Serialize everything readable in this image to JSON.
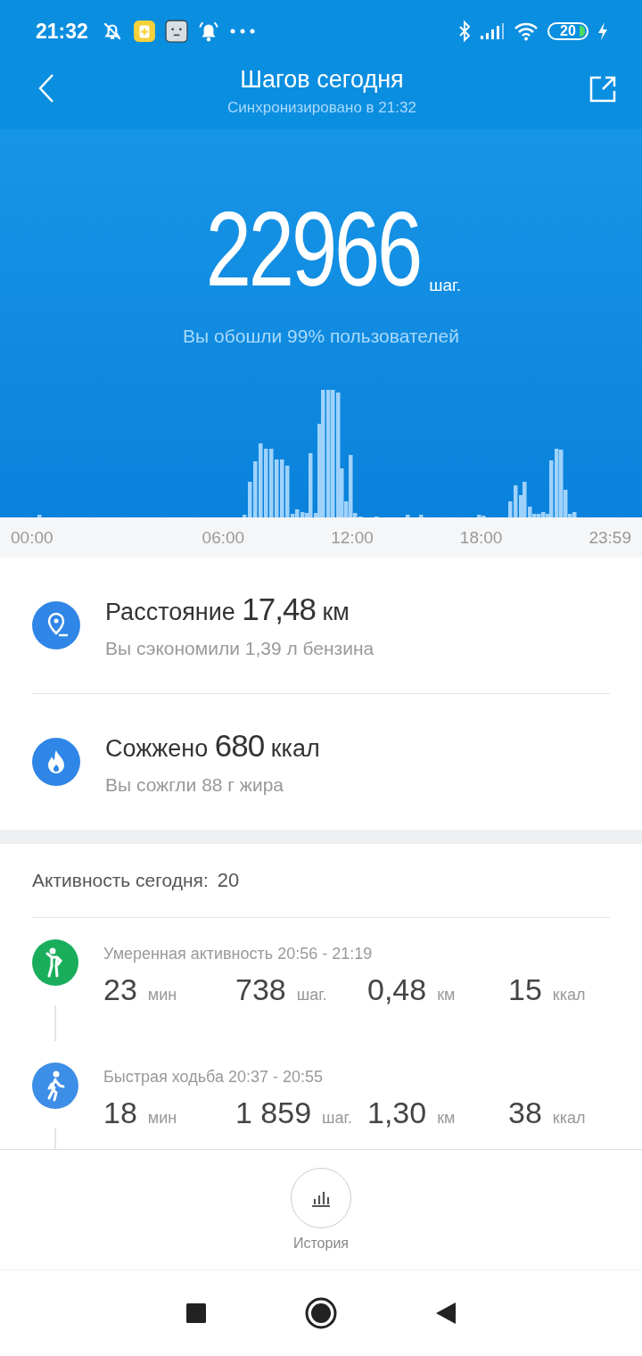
{
  "status_bar": {
    "time": "21:32",
    "battery": "20"
  },
  "header": {
    "title": "Шагов сегодня",
    "subtitle": "Синхронизировано в 21:32"
  },
  "summary": {
    "steps": "22966",
    "unit": "шаг.",
    "comparison": "Вы обошли 99% пользователей"
  },
  "chart_axis": [
    "00:00",
    "06:00",
    "12:00",
    "18:00",
    "23:59"
  ],
  "stats": [
    {
      "kind": "distance",
      "label": "Расстояние",
      "value": "17,48",
      "unit": "км",
      "note": "Вы сэкономили 1,39 л бензина"
    },
    {
      "kind": "calories",
      "label": "Сожжено",
      "value": "680",
      "unit": "ккал",
      "note": "Вы сожгли 88 г жира"
    }
  ],
  "activity": {
    "title": "Активность сегодня:",
    "count": "20",
    "items": [
      {
        "kind": "moderate",
        "color": "#1aae5c",
        "title": "Умеренная активность 20:56 - 21:19",
        "metrics": [
          {
            "value": "23",
            "unit": "мин"
          },
          {
            "value": "738",
            "unit": "шаг."
          },
          {
            "value": "0,48",
            "unit": "км"
          },
          {
            "value": "15",
            "unit": "ккал"
          }
        ]
      },
      {
        "kind": "walk",
        "color": "#3d8ee6",
        "title": "Быстрая ходьба 20:37 - 20:55",
        "metrics": [
          {
            "value": "18",
            "unit": "мин"
          },
          {
            "value": "1 859",
            "unit": "шаг."
          },
          {
            "value": "1,30",
            "unit": "км"
          },
          {
            "value": "38",
            "unit": "ккал"
          }
        ]
      }
    ]
  },
  "bottom": {
    "history_label": "История"
  }
}
